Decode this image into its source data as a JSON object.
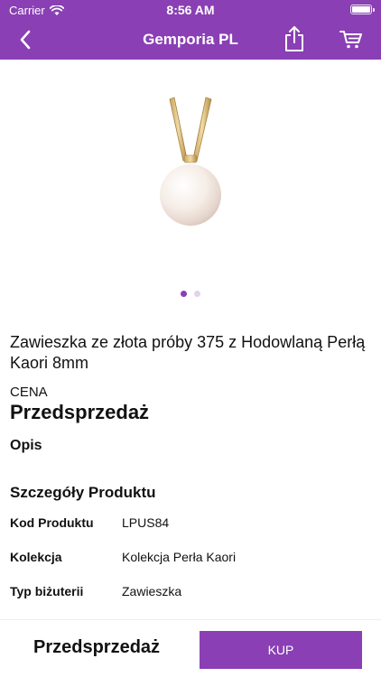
{
  "status_bar": {
    "carrier": "Carrier",
    "time": "8:56 AM",
    "battery_level": 1.0,
    "wifi_icon": "wifi-icon",
    "battery_icon": "battery-icon"
  },
  "nav": {
    "title": "Gemporia PL",
    "back_icon": "chevron-left-icon",
    "share_icon": "share-icon",
    "cart_icon": "cart-icon"
  },
  "colors": {
    "brand": "#8a3fb4",
    "dot_inactive": "#e2d2ec"
  },
  "gallery": {
    "image_count": 2,
    "active_index": 0
  },
  "product": {
    "title": "Zawieszka ze złota próby 375 z Hodowlaną Perłą Kaori 8mm",
    "price_label": "CENA",
    "price_value": "Przedsprzedaż",
    "description_heading": "Opis",
    "details_heading": "Szczegóły Produktu",
    "details": [
      {
        "key": "Kod Produktu",
        "value": "LPUS84"
      },
      {
        "key": "Kolekcja",
        "value": "Kolekcja Perła Kaori"
      },
      {
        "key": "Typ biżuterii",
        "value": "Zawieszka"
      }
    ]
  },
  "bottom_bar": {
    "price": "Przedsprzedaż",
    "buy_label": "KUP"
  }
}
